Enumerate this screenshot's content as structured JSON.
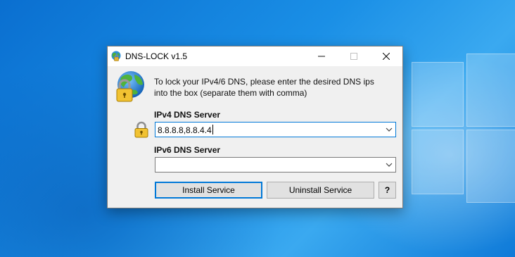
{
  "window": {
    "title": "DNS-LOCK v1.5",
    "minimize_glyph": "—",
    "maximize_glyph": "☐",
    "close_glyph": "✕"
  },
  "main": {
    "instruction_line1": "To lock your IPv4/6 DNS, please enter the desired DNS ips",
    "instruction_line2": "into the box (separate them with comma)",
    "ipv4": {
      "label": "IPv4 DNS Server",
      "value": "8.8.8.8,8.8.4.4"
    },
    "ipv6": {
      "label": "IPv6 DNS Server",
      "value": ""
    }
  },
  "buttons": {
    "install": "Install Service",
    "uninstall": "Uninstall Service",
    "help": "?"
  },
  "icons": {
    "app": "globe-lock-icon",
    "large": "globe-lock-icon",
    "field": "padlock-icon",
    "dropdown": "chevron-down-icon"
  },
  "colors": {
    "focus_accent": "#0078d7",
    "window_bg": "#f0f0f0",
    "desktop": "#1a8fe6"
  }
}
